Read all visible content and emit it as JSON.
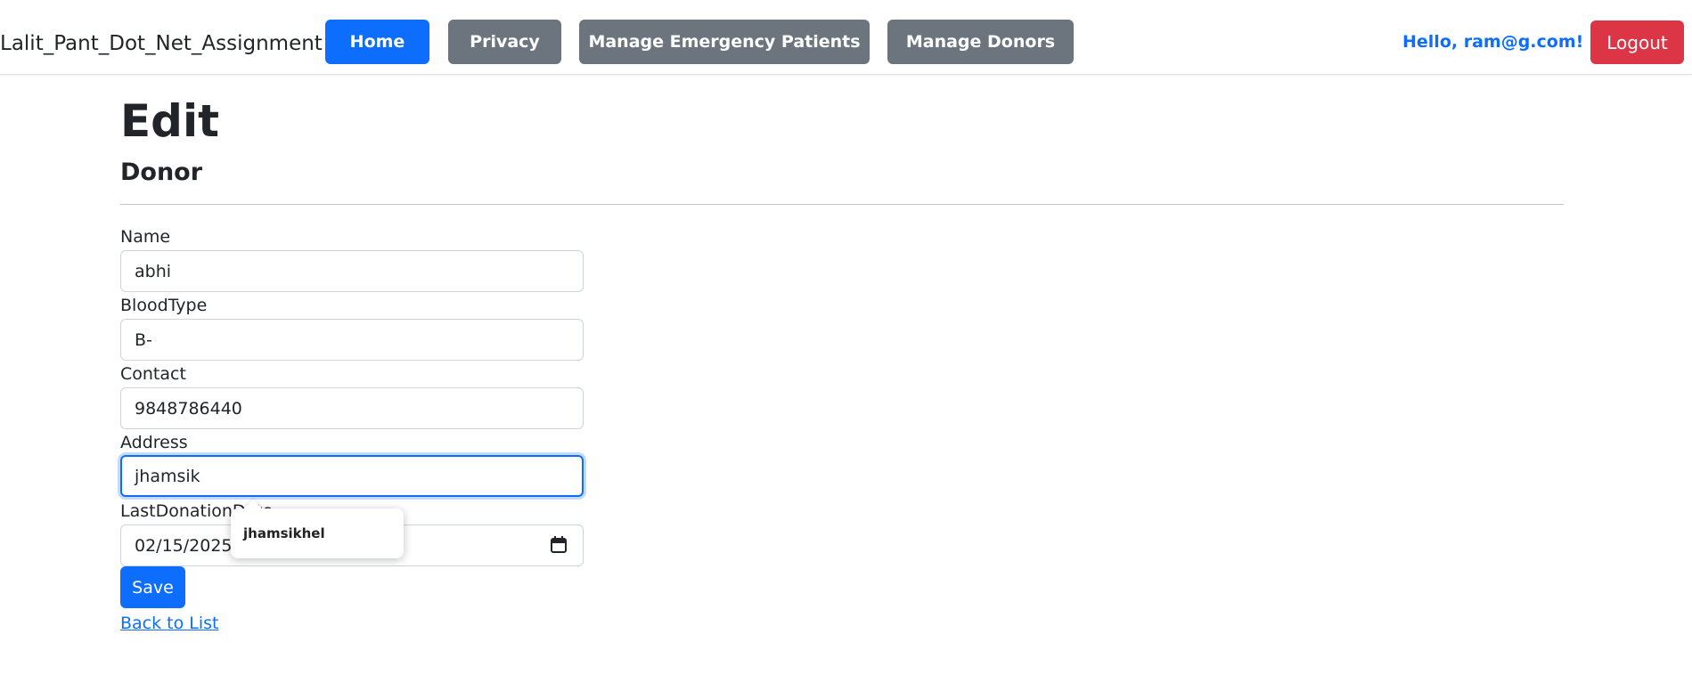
{
  "nav": {
    "brand": "Lalit_Pant_Dot_Net_Assignment",
    "links": [
      {
        "label": "Home",
        "style": "primary"
      },
      {
        "label": "Privacy",
        "style": "secondary"
      },
      {
        "label": "Manage Emergency Patients",
        "style": "secondary"
      },
      {
        "label": "Manage Donors",
        "style": "secondary"
      }
    ],
    "greeting": "Hello, ram@g.com!",
    "logout": "Logout"
  },
  "page": {
    "title": "Edit",
    "subtitle": "Donor"
  },
  "form": {
    "fields": [
      {
        "label": "Name",
        "value": "abhi"
      },
      {
        "label": "BloodType",
        "value": "B-"
      },
      {
        "label": "Contact",
        "value": "9848786440"
      },
      {
        "label": "Address",
        "value": "jhamsik"
      },
      {
        "label": "LastDonationDate",
        "value": "02/15/2025"
      }
    ],
    "autocomplete_suggestion": "jhamsikhel",
    "save_label": "Save",
    "back_link": "Back to List"
  },
  "colors": {
    "primary": "#0d6efd",
    "secondary": "#6c757d",
    "danger": "#dc3545"
  }
}
